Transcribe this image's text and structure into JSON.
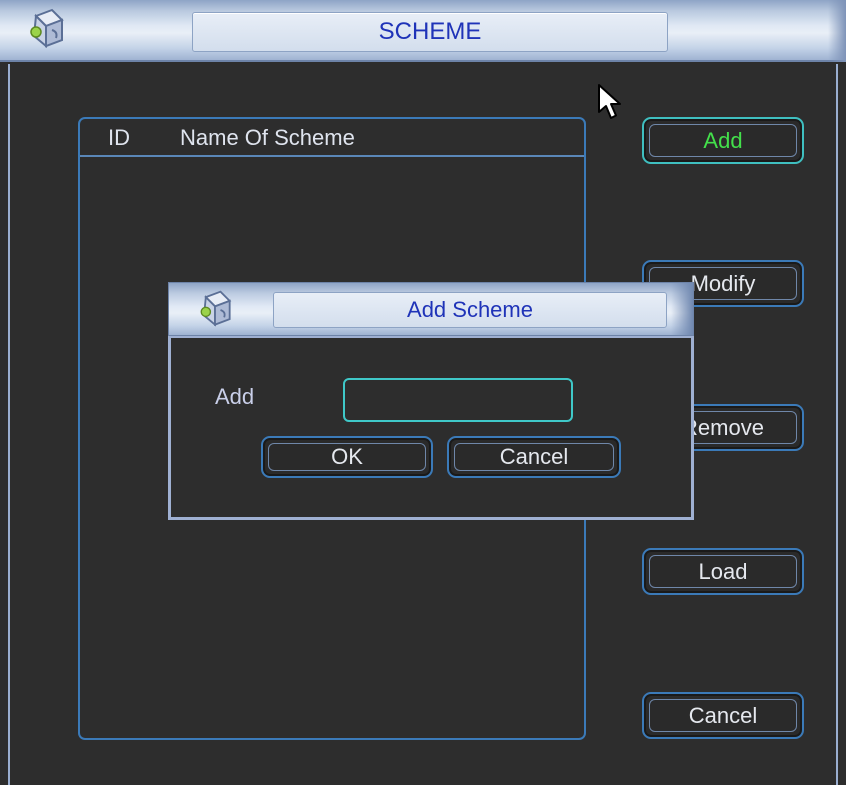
{
  "window": {
    "title": "SCHEME",
    "icon": "cube-app-icon"
  },
  "scheme_list": {
    "columns": [
      "ID",
      "Name Of Scheme"
    ],
    "rows": []
  },
  "side_buttons": {
    "add": "Add",
    "modify": "Modify",
    "remove": "Remove",
    "load": "Load",
    "cancel": "Cancel"
  },
  "dialog": {
    "title": "Add Scheme",
    "icon": "cube-app-icon",
    "field_label": "Add",
    "field_value": "",
    "ok": "OK",
    "cancel": "Cancel"
  },
  "colors": {
    "title_text": "#1f33b8",
    "button_border": "#3b7ab8",
    "focus_border": "#3fbfc0",
    "focused_text": "#43e04b",
    "background": "#2d2d2d"
  }
}
